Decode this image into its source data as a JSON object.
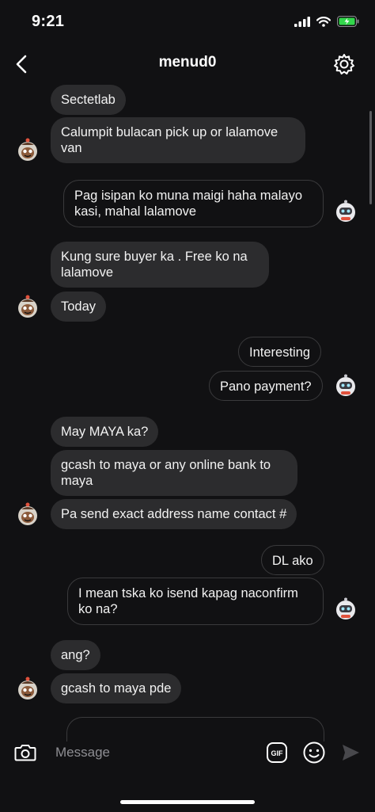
{
  "status": {
    "time": "9:21"
  },
  "header": {
    "title": "menud0"
  },
  "messages": [
    {
      "text": "Sectetlab"
    },
    {
      "text": "Calumpit bulacan pick up or lalamove van"
    },
    {
      "text": "Pag isipan ko muna maigi haha malayo kasi, mahal lalamove"
    },
    {
      "text": "Kung sure buyer ka . Free ko na lalamove"
    },
    {
      "text": "Today"
    },
    {
      "text": "Interesting"
    },
    {
      "text": "Pano payment?"
    },
    {
      "text": "May MAYA ka?"
    },
    {
      "text": "gcash to maya or any online bank to maya"
    },
    {
      "text": "Pa send exact address name contact #"
    },
    {
      "text": "DL ako"
    },
    {
      "text": "I mean tska ko isend kapag naconfirm ko na?"
    },
    {
      "text": "ang?"
    },
    {
      "text": "gcash to maya pde"
    }
  ],
  "composer": {
    "placeholder": "Message",
    "gif_label": "GIF"
  },
  "icons": {
    "back": "chevron-left-icon",
    "settings": "gear-icon",
    "camera": "camera-icon",
    "emoji": "emoji-icon",
    "send": "send-arrow-icon"
  },
  "colors": {
    "background": "#111113",
    "incoming_bubble": "#2c2c2e",
    "outgoing_border": "#3a3a3c"
  }
}
